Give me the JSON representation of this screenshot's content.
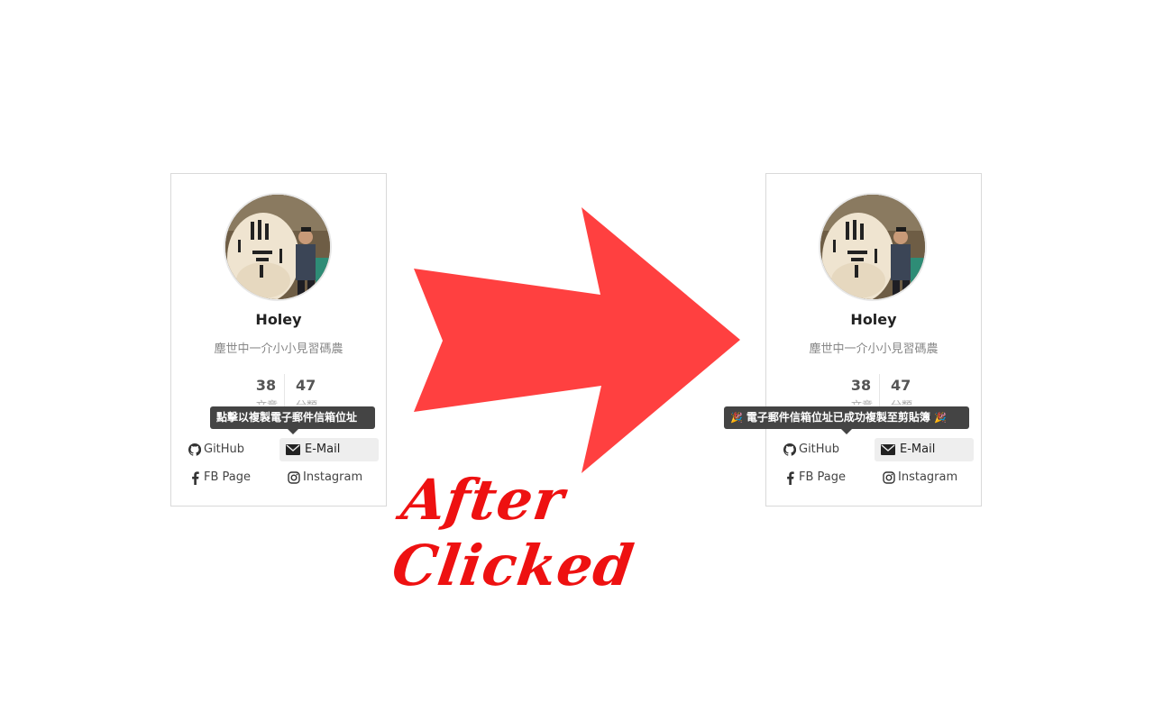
{
  "profile": {
    "name": "Holey",
    "motto": "塵世中一介小小見習碼農",
    "stat_1": "38",
    "stat_2": "47",
    "stat_1_sub": "文章",
    "stat_2_sub": "分類"
  },
  "links": {
    "github": "GitHub",
    "email": "E-Mail",
    "fb": "FB Page",
    "instagram": "Instagram"
  },
  "tooltips": {
    "before": "點擊以複製電子郵件信箱位址",
    "after": "電子郵件信箱位址已成功複製至剪貼簿",
    "emoji": "🎉"
  },
  "caption": "After Clicked",
  "colors": {
    "arrow": "#ff4040",
    "caption": "#ee1111",
    "tooltip_bg": "#444444"
  },
  "icons": [
    "github-icon",
    "envelope-icon",
    "facebook-icon",
    "instagram-icon",
    "party-popper-icon",
    "right-arrow"
  ]
}
